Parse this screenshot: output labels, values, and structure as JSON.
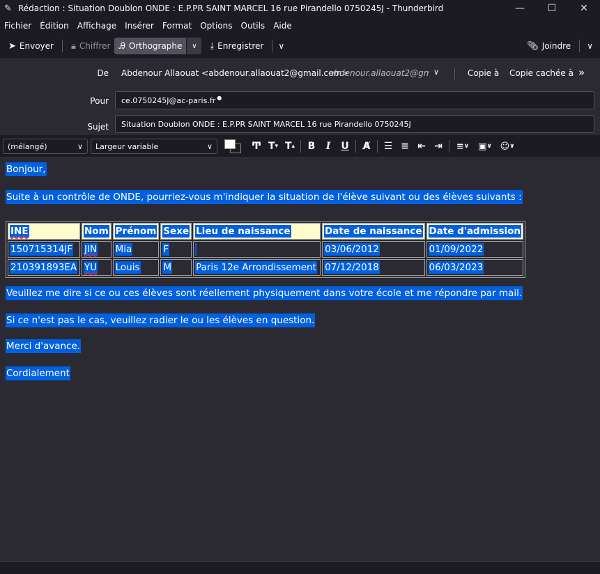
{
  "window": {
    "title": "Rédaction : Situation Doublon ONDE : E.P.PR SAINT MARCEL 16 rue Pirandello 0750245J - Thunderbird",
    "minimize": "—",
    "maximize": "☐",
    "close": "✕"
  },
  "menu": {
    "items": [
      {
        "label": "Fichier"
      },
      {
        "label": "Édition"
      },
      {
        "label": "Affichage"
      },
      {
        "label": "Insérer"
      },
      {
        "label": "Format"
      },
      {
        "label": "Options"
      },
      {
        "label": "Outils"
      },
      {
        "label": "Aide"
      }
    ]
  },
  "toolbar": {
    "send": "Envoyer",
    "encrypt": "Chiffrer",
    "spelling": "Orthographe",
    "save": "Enregistrer",
    "attach": "Joindre"
  },
  "headers": {
    "from_label": "De",
    "from_name": "Abdenour Allaouat <abdenour.allaouat2@gmail.com>",
    "from_alias": "abdenour.allaouat2@gm...",
    "cc_label": "Copie à",
    "bcc_label": "Copie cachée à",
    "to_label": "Pour",
    "to_value": "ce.0750245J@ac-paris.fr",
    "subject_label": "Sujet",
    "subject_value": "Situation Doublon ONDE : E.P.PR SAINT MARCEL 16 rue Pirandello 0750245J"
  },
  "format": {
    "paragraph": "(mélangé)",
    "font": "Largeur variable"
  },
  "message": {
    "greeting": "Bonjour,",
    "intro": "Suite à un contrôle de ONDE, pourriez-vous m'indiquer la situation de l'élève suivant ou des élèves suivants :",
    "table": {
      "headers": [
        "INE",
        "Nom",
        "Prénom",
        "Sexe",
        "Lieu de naissance",
        "Date de naissance",
        "Date d'admission"
      ],
      "rows": [
        [
          "150715314JF",
          "JIN",
          "Mia",
          "F",
          "",
          "03/06/2012",
          "01/09/2022"
        ],
        [
          "210391893EA",
          "YU",
          "Louis",
          "M",
          "Paris 12e Arrondissement",
          "07/12/2018",
          "06/03/2023"
        ]
      ]
    },
    "request": "Veuillez me dire si ce ou ces élèves sont réellement physiquement dans votre école et me répondre par mail.",
    "removal": "Si ce n'est pas le cas, veuillez radier le ou les élèves en question.",
    "thanks": "Merci d'avance.",
    "closing": "Cordialement"
  }
}
